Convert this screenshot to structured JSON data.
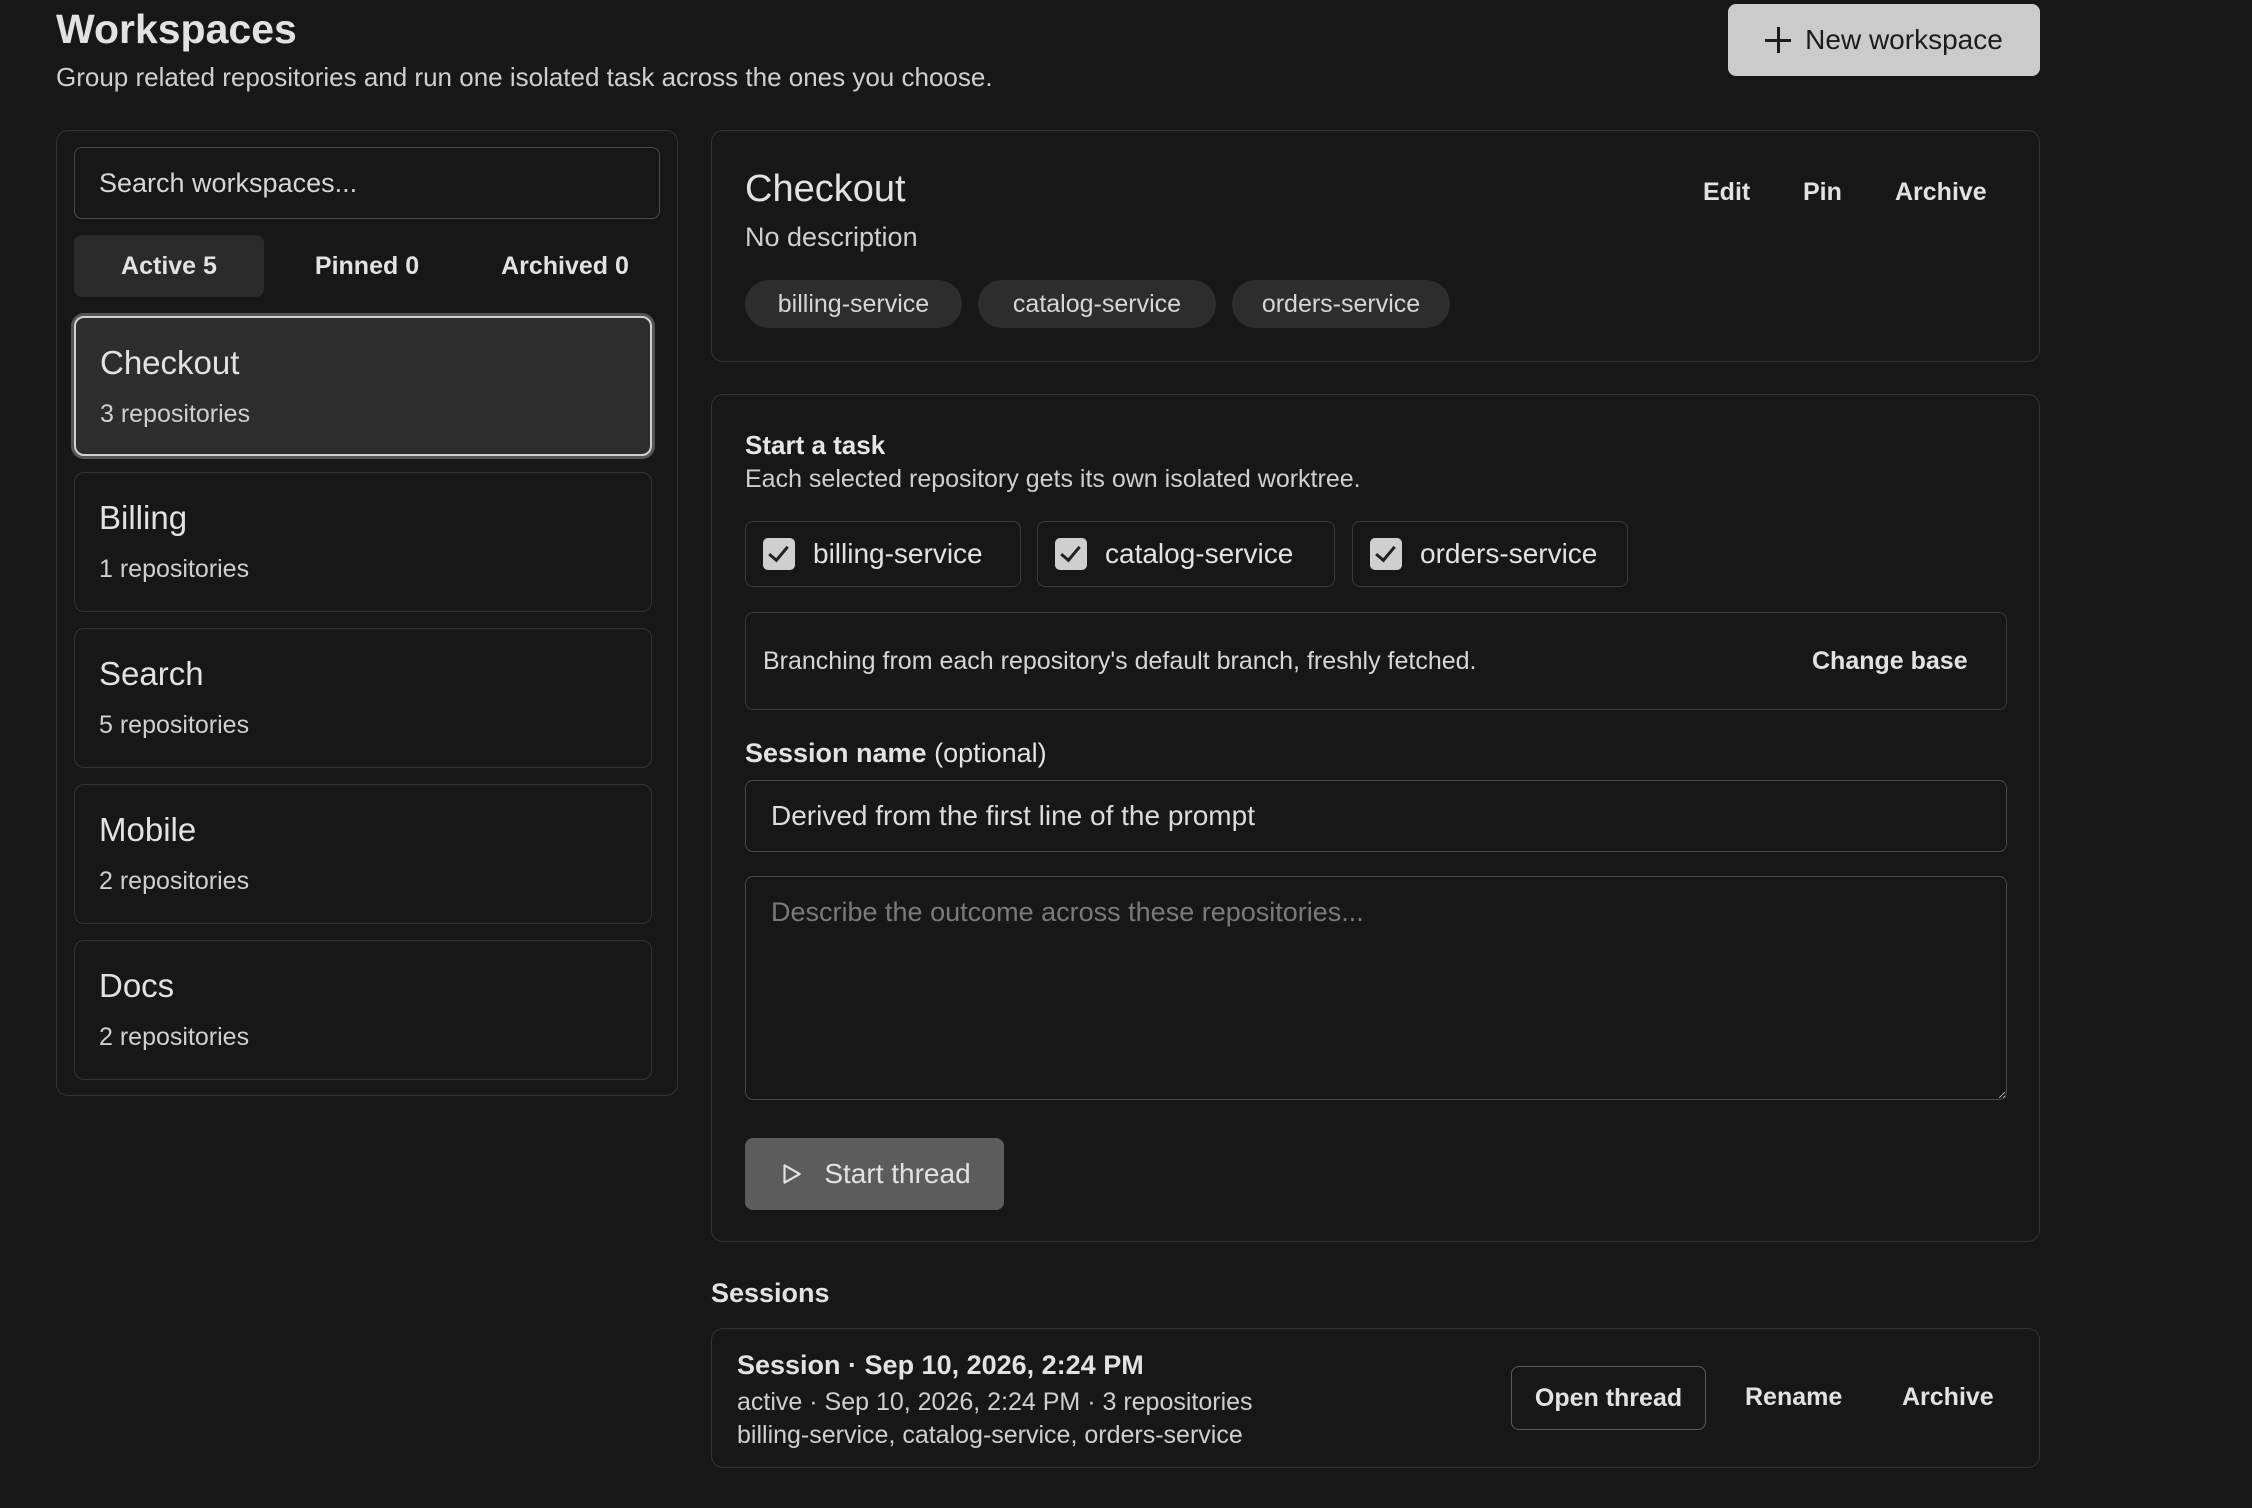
{
  "header": {
    "title": "Workspaces",
    "subtitle": "Group related repositories and run one isolated task across the ones you choose.",
    "new_button_label": "New workspace"
  },
  "sidebar": {
    "search_placeholder": "Search workspaces...",
    "filters": [
      {
        "label": "Active 5",
        "active": true
      },
      {
        "label": "Pinned 0",
        "active": false
      },
      {
        "label": "Archived 0",
        "active": false
      }
    ],
    "workspaces": [
      {
        "name": "Checkout",
        "count": "3 repositories",
        "selected": true
      },
      {
        "name": "Billing",
        "count": "1 repositories",
        "selected": false
      },
      {
        "name": "Search",
        "count": "5 repositories",
        "selected": false
      },
      {
        "name": "Mobile",
        "count": "2 repositories",
        "selected": false
      },
      {
        "name": "Docs",
        "count": "2 repositories",
        "selected": false
      }
    ]
  },
  "detail": {
    "title": "Checkout",
    "description": "No description",
    "actions": [
      "Edit",
      "Pin",
      "Archive"
    ],
    "repos": [
      "billing-service",
      "catalog-service",
      "orders-service"
    ]
  },
  "task": {
    "heading": "Start a task",
    "subtitle": "Each selected repository gets its own isolated worktree.",
    "repos": [
      {
        "label": "billing-service",
        "checked": true
      },
      {
        "label": "catalog-service",
        "checked": true
      },
      {
        "label": "orders-service",
        "checked": true
      }
    ],
    "branch_text": "Branching from each repository's default branch, freshly fetched.",
    "change_base_label": "Change base",
    "session_label": "Session name",
    "session_label_optional": "(optional)",
    "session_placeholder": "Derived from the first line of the prompt",
    "prompt_placeholder": "Describe the outcome across these repositories...",
    "start_button_label": "Start thread"
  },
  "sessions": {
    "heading": "Sessions",
    "items": [
      {
        "title": "Session · Sep 10, 2026, 2:24 PM",
        "meta": "active · Sep 10, 2026, 2:24 PM · 3 repositories",
        "repos": "billing-service, catalog-service, orders-service",
        "open_label": "Open thread",
        "rename_label": "Rename",
        "archive_label": "Archive"
      }
    ]
  },
  "colors": {
    "background": "#171717",
    "border": "#333333",
    "primary_button": "#cbcbcb",
    "disabled_button": "#5c5c5c"
  }
}
